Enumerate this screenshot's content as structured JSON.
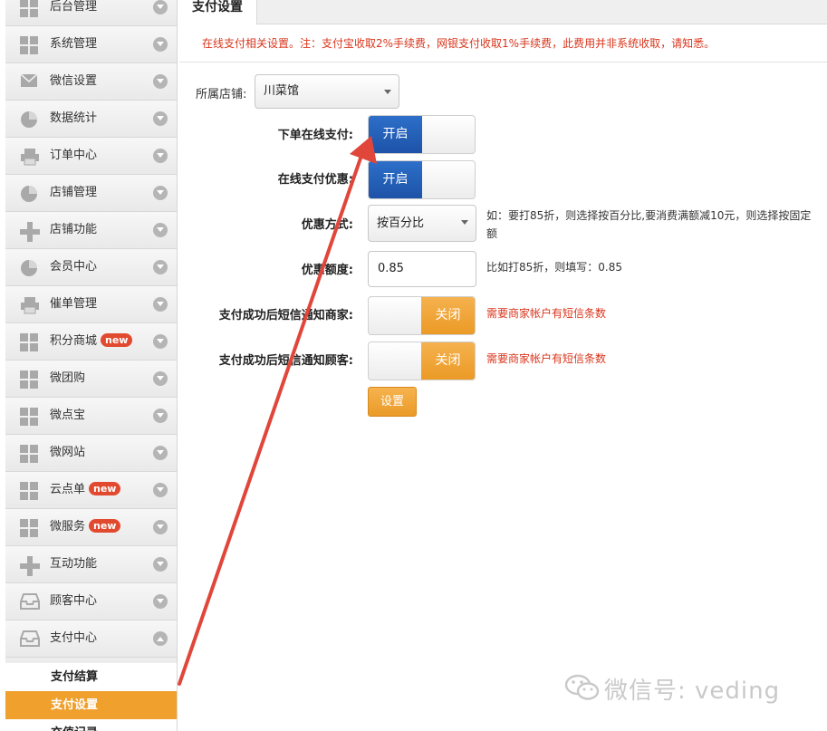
{
  "sidebar": {
    "items": [
      {
        "label": "后台管理",
        "icon": "grid-icon"
      },
      {
        "label": "系统管理",
        "icon": "grid-icon"
      },
      {
        "label": "微信设置",
        "icon": "envelope-icon"
      },
      {
        "label": "数据统计",
        "icon": "pie-chart-icon"
      },
      {
        "label": "订单中心",
        "icon": "printer-icon"
      },
      {
        "label": "店铺管理",
        "icon": "pie-chart-icon"
      },
      {
        "label": "店铺功能",
        "icon": "plus-icon"
      },
      {
        "label": "会员中心",
        "icon": "pie-chart-icon"
      },
      {
        "label": "催单管理",
        "icon": "printer-icon"
      },
      {
        "label": "积分商城",
        "icon": "grid-icon",
        "badge": "new"
      },
      {
        "label": "微团购",
        "icon": "grid-icon"
      },
      {
        "label": "微点宝",
        "icon": "grid-icon"
      },
      {
        "label": "微网站",
        "icon": "grid-icon"
      },
      {
        "label": "云点单",
        "icon": "grid-icon",
        "badge": "new"
      },
      {
        "label": "微服务",
        "icon": "grid-icon",
        "badge": "new"
      },
      {
        "label": "互动功能",
        "icon": "plus-icon"
      },
      {
        "label": "顾客中心",
        "icon": "inbox-icon"
      },
      {
        "label": "支付中心",
        "icon": "inbox-icon",
        "expanded": true
      }
    ],
    "sub_items": [
      {
        "label": "支付结算",
        "active": false
      },
      {
        "label": "支付设置",
        "active": true
      },
      {
        "label": "充值记录",
        "active": false
      }
    ]
  },
  "tab": {
    "label": "支付设置"
  },
  "notice": "在线支付相关设置。注：支付宝收取2%手续费，网银支付收取1%手续费，此费用并非系统收取，请知悉。",
  "form": {
    "store": {
      "label": "所属店铺:",
      "value": "川菜馆"
    },
    "online_pay": {
      "label": "下单在线支付:",
      "state": "开启"
    },
    "online_discount": {
      "label": "在线支付优惠:",
      "state": "开启"
    },
    "discount_mode": {
      "label": "优惠方式:",
      "value": "按百分比",
      "hint": "如：要打85折，则选择按百分比,要消费满额减10元，则选择按固定额"
    },
    "discount_amount": {
      "label": "优惠额度:",
      "value": "0.85",
      "hint": "比如打85折，则填写：0.85"
    },
    "sms_merchant": {
      "label": "支付成功后短信通知商家:",
      "state": "关闭",
      "hint": "需要商家帐户有短信条数"
    },
    "sms_customer": {
      "label": "支付成功后短信通知顾客:",
      "state": "关闭",
      "hint": "需要商家帐户有短信条数"
    },
    "submit_label": "设置"
  },
  "watermark": "微信号: veding",
  "colors": {
    "accent_orange": "#f0a02c",
    "toggle_blue": "#1d53a8",
    "notice_red": "#d9351c",
    "arrow_red": "#e0463a"
  }
}
